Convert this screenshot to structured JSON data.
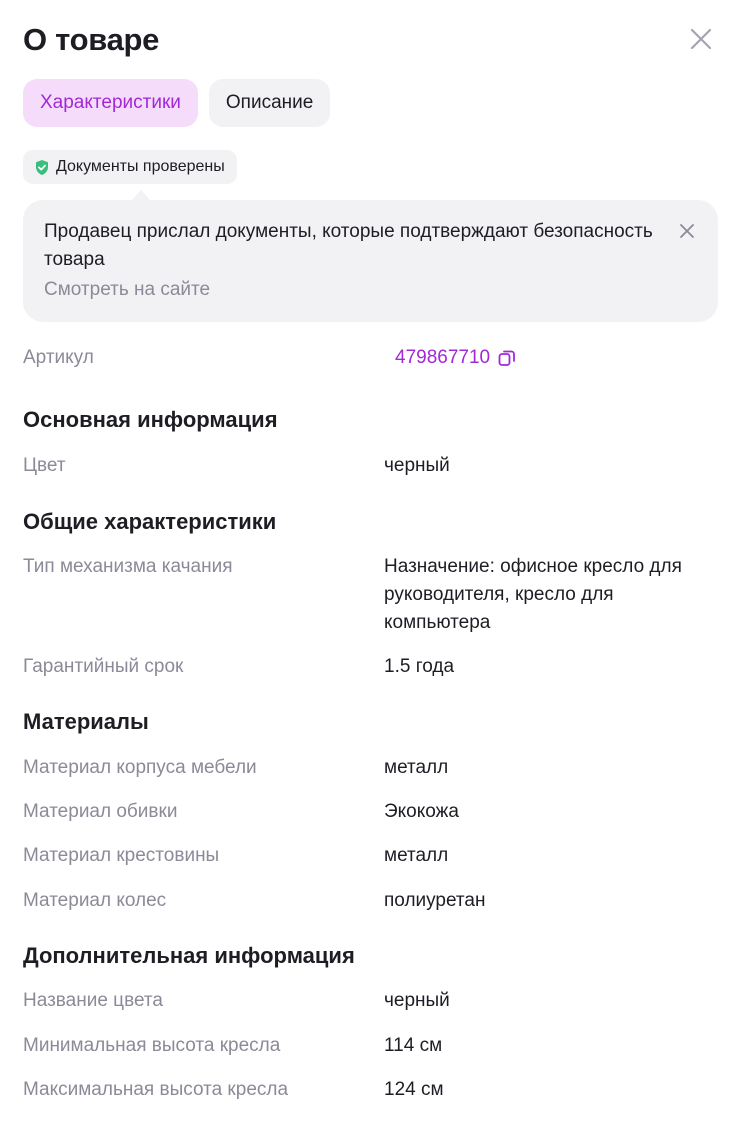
{
  "header": {
    "title": "О товаре"
  },
  "tabs": [
    {
      "label": "Характеристики",
      "active": true
    },
    {
      "label": "Описание",
      "active": false
    }
  ],
  "badge": {
    "icon": "shield-check-icon",
    "icon_color": "#3dbd7d",
    "label": "Документы проверены"
  },
  "tooltip": {
    "text": "Продавец прислал документы, которые подтверждают безопасность товара",
    "link": "Смотреть на сайте"
  },
  "article": {
    "label": "Артикул",
    "value": "479867710",
    "icon": "copy-icon"
  },
  "sections": [
    {
      "title": "Основная информация",
      "rows": [
        {
          "label": "Цвет",
          "value": "черный"
        }
      ]
    },
    {
      "title": "Общие характеристики",
      "rows": [
        {
          "label": "Тип механизма качания",
          "value": "Назначение: офисное кресло для руководителя, кресло для компьютера"
        },
        {
          "label": "Гарантийный срок",
          "value": "1.5 года"
        }
      ]
    },
    {
      "title": "Материалы",
      "rows": [
        {
          "label": "Материал корпуса мебели",
          "value": "металл"
        },
        {
          "label": "Материал обивки",
          "value": "Экокожа"
        },
        {
          "label": "Материал крестовины",
          "value": "металл"
        },
        {
          "label": "Материал колес",
          "value": "полиуретан"
        }
      ]
    },
    {
      "title": "Дополнительная информация",
      "rows": [
        {
          "label": "Название цвета",
          "value": "черный"
        },
        {
          "label": "Минимальная высота кресла",
          "value": "114 см"
        },
        {
          "label": "Максимальная высота кресла",
          "value": "124 см"
        }
      ]
    }
  ],
  "colors": {
    "accent": "#a228d8",
    "accent_bg": "#f6dcfb",
    "muted_text": "#8b8a98",
    "panel_bg": "#f2f2f4",
    "verified_green": "#3dbd7d"
  }
}
